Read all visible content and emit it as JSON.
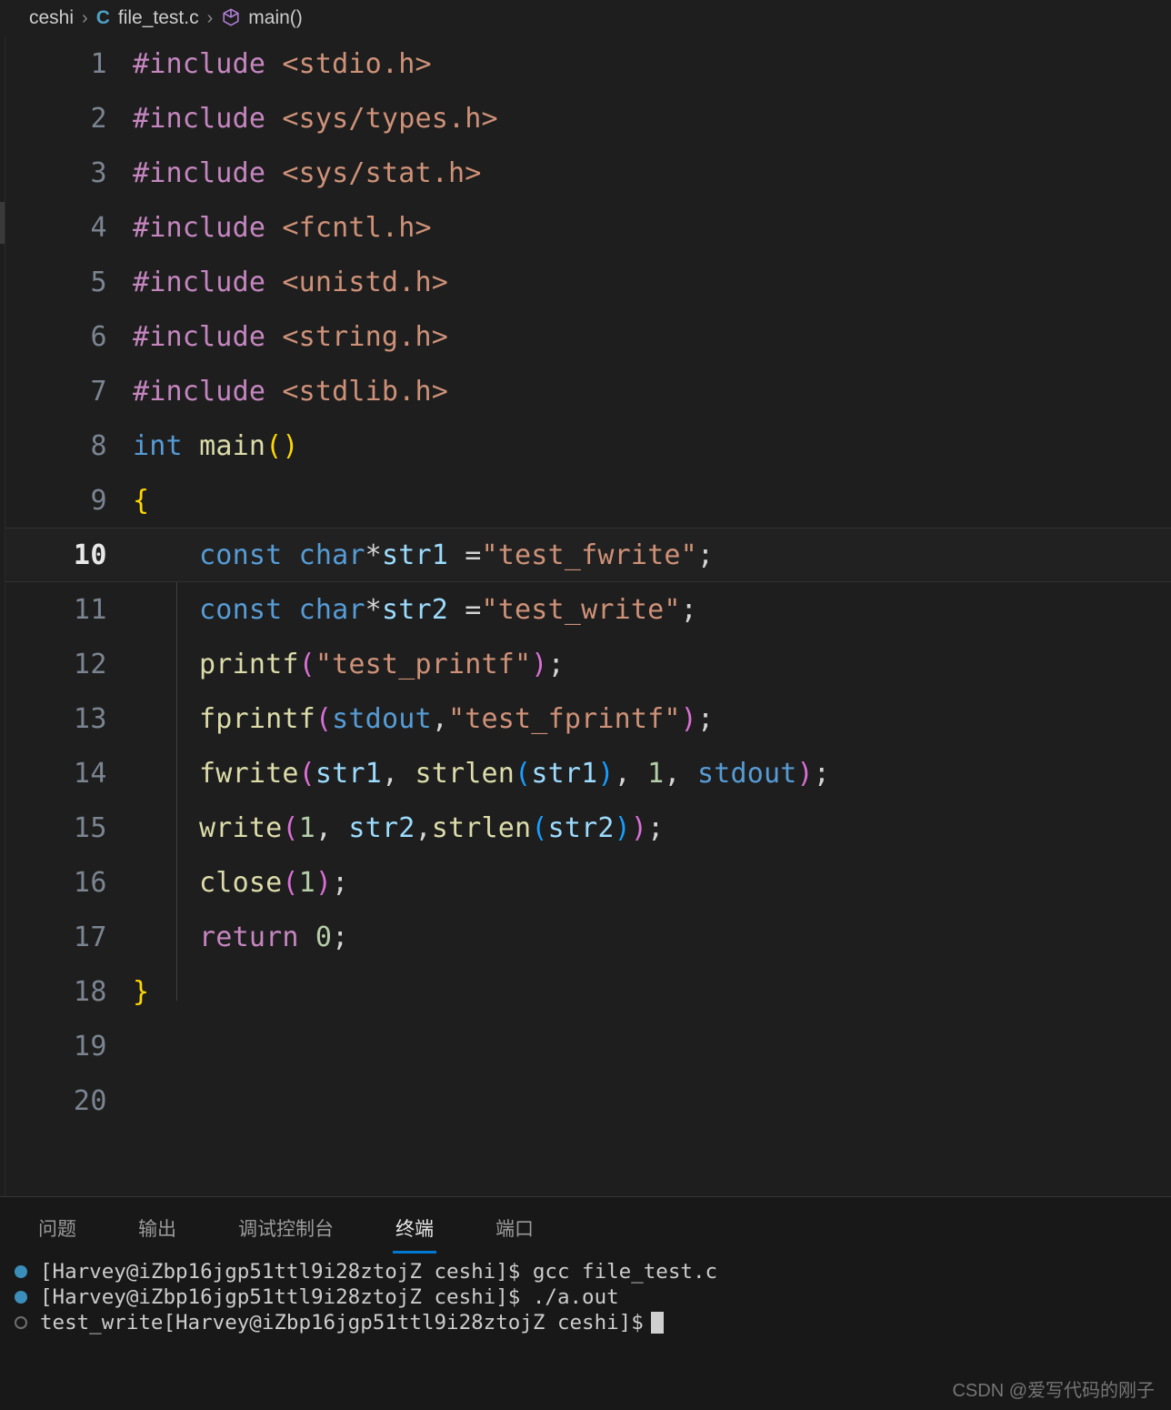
{
  "breadcrumb": {
    "folder": "ceshi",
    "separator": "›",
    "file_icon": "C",
    "file": "file_test.c",
    "symbol_icon": "cube-icon",
    "symbol": "main()"
  },
  "editor": {
    "background": "#1e1e1e",
    "current_line": 10,
    "total_lines": 20,
    "lines": [
      {
        "n": "1",
        "tokens": [
          {
            "t": "#include ",
            "c": "t-pre"
          },
          {
            "t": "<stdio.h>",
            "c": "t-str"
          }
        ]
      },
      {
        "n": "2",
        "tokens": [
          {
            "t": "#include ",
            "c": "t-pre"
          },
          {
            "t": "<sys/types.h>",
            "c": "t-str"
          }
        ]
      },
      {
        "n": "3",
        "tokens": [
          {
            "t": "#include ",
            "c": "t-pre"
          },
          {
            "t": "<sys/stat.h>",
            "c": "t-str"
          }
        ]
      },
      {
        "n": "4",
        "tokens": [
          {
            "t": "#include ",
            "c": "t-pre"
          },
          {
            "t": "<fcntl.h>",
            "c": "t-str"
          }
        ]
      },
      {
        "n": "5",
        "tokens": [
          {
            "t": "#include ",
            "c": "t-pre"
          },
          {
            "t": "<unistd.h>",
            "c": "t-str"
          }
        ]
      },
      {
        "n": "6",
        "tokens": [
          {
            "t": "#include ",
            "c": "t-pre"
          },
          {
            "t": "<string.h>",
            "c": "t-str"
          }
        ]
      },
      {
        "n": "7",
        "tokens": [
          {
            "t": "#include ",
            "c": "t-pre"
          },
          {
            "t": "<stdlib.h>",
            "c": "t-str"
          }
        ]
      },
      {
        "n": "8",
        "tokens": [
          {
            "t": "int",
            "c": "t-kw"
          },
          {
            "t": " ",
            "c": "t-plain"
          },
          {
            "t": "main",
            "c": "t-fn"
          },
          {
            "t": "()",
            "c": "t-br1"
          }
        ]
      },
      {
        "n": "9",
        "tokens": [
          {
            "t": "{",
            "c": "t-br1"
          }
        ]
      },
      {
        "n": "10",
        "tokens": [
          {
            "t": "    ",
            "c": "t-plain"
          },
          {
            "t": "const",
            "c": "t-kw"
          },
          {
            "t": " ",
            "c": "t-plain"
          },
          {
            "t": "char",
            "c": "t-kw"
          },
          {
            "t": "*",
            "c": "t-plain"
          },
          {
            "t": "str1",
            "c": "t-var"
          },
          {
            "t": " =",
            "c": "t-plain"
          },
          {
            "t": "\"test_fwrite\"",
            "c": "t-str"
          },
          {
            "t": ";",
            "c": "t-plain"
          }
        ]
      },
      {
        "n": "11",
        "tokens": [
          {
            "t": "    ",
            "c": "t-plain"
          },
          {
            "t": "const",
            "c": "t-kw"
          },
          {
            "t": " ",
            "c": "t-plain"
          },
          {
            "t": "char",
            "c": "t-kw"
          },
          {
            "t": "*",
            "c": "t-plain"
          },
          {
            "t": "str2",
            "c": "t-var"
          },
          {
            "t": " =",
            "c": "t-plain"
          },
          {
            "t": "\"test_write\"",
            "c": "t-str"
          },
          {
            "t": ";",
            "c": "t-plain"
          }
        ]
      },
      {
        "n": "12",
        "tokens": [
          {
            "t": "    ",
            "c": "t-plain"
          },
          {
            "t": "printf",
            "c": "t-fn"
          },
          {
            "t": "(",
            "c": "t-br2"
          },
          {
            "t": "\"test_printf\"",
            "c": "t-str"
          },
          {
            "t": ")",
            "c": "t-br2"
          },
          {
            "t": ";",
            "c": "t-plain"
          }
        ]
      },
      {
        "n": "13",
        "tokens": [
          {
            "t": "    ",
            "c": "t-plain"
          },
          {
            "t": "fprintf",
            "c": "t-fn"
          },
          {
            "t": "(",
            "c": "t-br2"
          },
          {
            "t": "stdout",
            "c": "t-kw"
          },
          {
            "t": ",",
            "c": "t-plain"
          },
          {
            "t": "\"test_fprintf\"",
            "c": "t-str"
          },
          {
            "t": ")",
            "c": "t-br2"
          },
          {
            "t": ";",
            "c": "t-plain"
          }
        ]
      },
      {
        "n": "14",
        "tokens": [
          {
            "t": "    ",
            "c": "t-plain"
          },
          {
            "t": "fwrite",
            "c": "t-fn"
          },
          {
            "t": "(",
            "c": "t-br2"
          },
          {
            "t": "str1",
            "c": "t-var"
          },
          {
            "t": ", ",
            "c": "t-plain"
          },
          {
            "t": "strlen",
            "c": "t-fn"
          },
          {
            "t": "(",
            "c": "t-br3"
          },
          {
            "t": "str1",
            "c": "t-var"
          },
          {
            "t": ")",
            "c": "t-br3"
          },
          {
            "t": ", ",
            "c": "t-plain"
          },
          {
            "t": "1",
            "c": "t-num"
          },
          {
            "t": ", ",
            "c": "t-plain"
          },
          {
            "t": "stdout",
            "c": "t-kw"
          },
          {
            "t": ")",
            "c": "t-br2"
          },
          {
            "t": ";",
            "c": "t-plain"
          }
        ]
      },
      {
        "n": "15",
        "tokens": [
          {
            "t": "    ",
            "c": "t-plain"
          },
          {
            "t": "write",
            "c": "t-fn"
          },
          {
            "t": "(",
            "c": "t-br2"
          },
          {
            "t": "1",
            "c": "t-num"
          },
          {
            "t": ", ",
            "c": "t-plain"
          },
          {
            "t": "str2",
            "c": "t-var"
          },
          {
            "t": ",",
            "c": "t-plain"
          },
          {
            "t": "strlen",
            "c": "t-fn"
          },
          {
            "t": "(",
            "c": "t-br3"
          },
          {
            "t": "str2",
            "c": "t-var"
          },
          {
            "t": ")",
            "c": "t-br3"
          },
          {
            "t": ")",
            "c": "t-br2"
          },
          {
            "t": ";",
            "c": "t-plain"
          }
        ]
      },
      {
        "n": "16",
        "tokens": [
          {
            "t": "    ",
            "c": "t-plain"
          },
          {
            "t": "close",
            "c": "t-fn"
          },
          {
            "t": "(",
            "c": "t-br2"
          },
          {
            "t": "1",
            "c": "t-num"
          },
          {
            "t": ")",
            "c": "t-br2"
          },
          {
            "t": ";",
            "c": "t-plain"
          }
        ]
      },
      {
        "n": "17",
        "tokens": [
          {
            "t": "    ",
            "c": "t-plain"
          },
          {
            "t": "return",
            "c": "t-pre"
          },
          {
            "t": " ",
            "c": "t-plain"
          },
          {
            "t": "0",
            "c": "t-num"
          },
          {
            "t": ";",
            "c": "t-plain"
          }
        ]
      },
      {
        "n": "18",
        "tokens": [
          {
            "t": "}",
            "c": "t-br1"
          }
        ]
      },
      {
        "n": "19",
        "tokens": []
      },
      {
        "n": "20",
        "tokens": []
      }
    ]
  },
  "panel": {
    "tabs": [
      {
        "label": "问题",
        "active": false
      },
      {
        "label": "输出",
        "active": false
      },
      {
        "label": "调试控制台",
        "active": false
      },
      {
        "label": "终端",
        "active": true
      },
      {
        "label": "端口",
        "active": false
      }
    ],
    "active_tab_color": "#0078d4"
  },
  "terminal": {
    "prompt": "[Harvey@iZbp16jgp51ttl9i28ztojZ ceshi]$",
    "lines": [
      {
        "marker": "filled",
        "text": "[Harvey@iZbp16jgp51ttl9i28ztojZ ceshi]$ gcc file_test.c",
        "cursor": false
      },
      {
        "marker": "filled",
        "text": "[Harvey@iZbp16jgp51ttl9i28ztojZ ceshi]$ ./a.out",
        "cursor": false
      },
      {
        "marker": "hollow",
        "text": "test_write[Harvey@iZbp16jgp51ttl9i28ztojZ ceshi]$",
        "cursor": true
      }
    ]
  },
  "watermark": "CSDN @爱写代码的刚子"
}
